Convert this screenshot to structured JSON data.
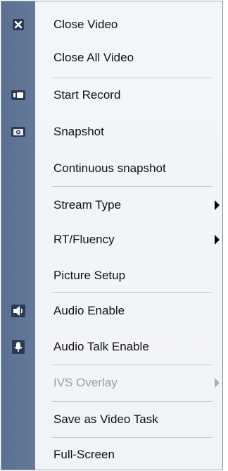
{
  "menu": {
    "items": [
      {
        "label": "Close Video",
        "icon": "close-icon"
      },
      {
        "label": "Close All Video"
      },
      {
        "label": "Start Record",
        "icon": "record-icon"
      },
      {
        "label": "Snapshot",
        "icon": "camera-icon"
      },
      {
        "label": "Continuous snapshot"
      },
      {
        "label": "Stream Type",
        "submenu": true
      },
      {
        "label": "RT/Fluency",
        "submenu": true
      },
      {
        "label": "Picture Setup"
      },
      {
        "label": "Audio Enable",
        "icon": "speaker-icon"
      },
      {
        "label": "Audio Talk Enable",
        "icon": "microphone-icon"
      },
      {
        "label": "IVS Overlay",
        "submenu": true,
        "disabled": true
      },
      {
        "label": "Save as Video Task"
      },
      {
        "label": "Full-Screen"
      }
    ]
  }
}
